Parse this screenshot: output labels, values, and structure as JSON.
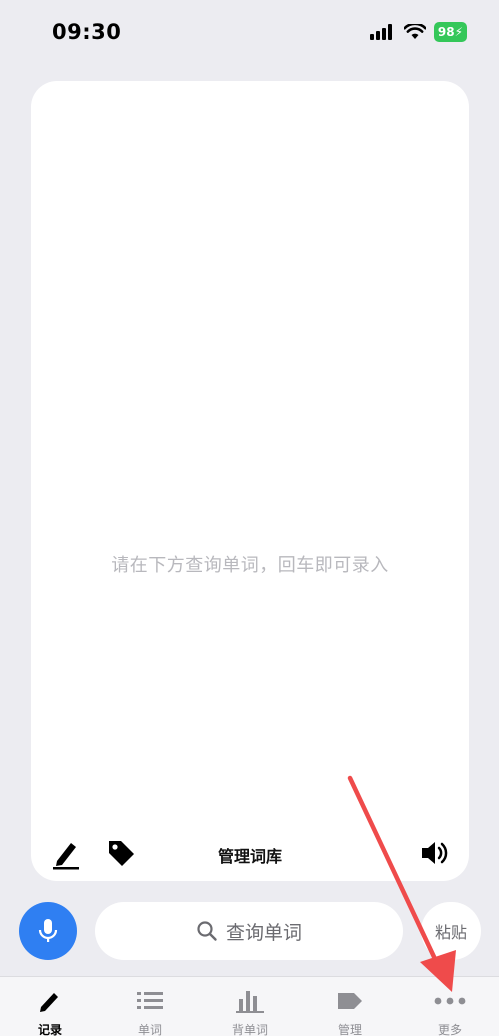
{
  "status_bar": {
    "time": "09:30",
    "battery": "98",
    "battery_color": "#34c759"
  },
  "card": {
    "hint": "请在下方查询单词，回车即可录入",
    "toolbar": {
      "title": "管理词库"
    }
  },
  "input_row": {
    "search_label": "查询单词",
    "paste_label": "粘贴",
    "mic_color": "#2f7ff2"
  },
  "tabs": [
    {
      "label": "记录",
      "icon": "pencil-icon",
      "active": true
    },
    {
      "label": "单词",
      "icon": "list-icon",
      "active": false
    },
    {
      "label": "背单词",
      "icon": "bar-chart-icon",
      "active": false
    },
    {
      "label": "管理",
      "icon": "tag-icon",
      "active": false
    },
    {
      "label": "更多",
      "icon": "more-icon",
      "active": false
    }
  ],
  "annotation": {
    "arrow_color": "#ef4b4b"
  }
}
